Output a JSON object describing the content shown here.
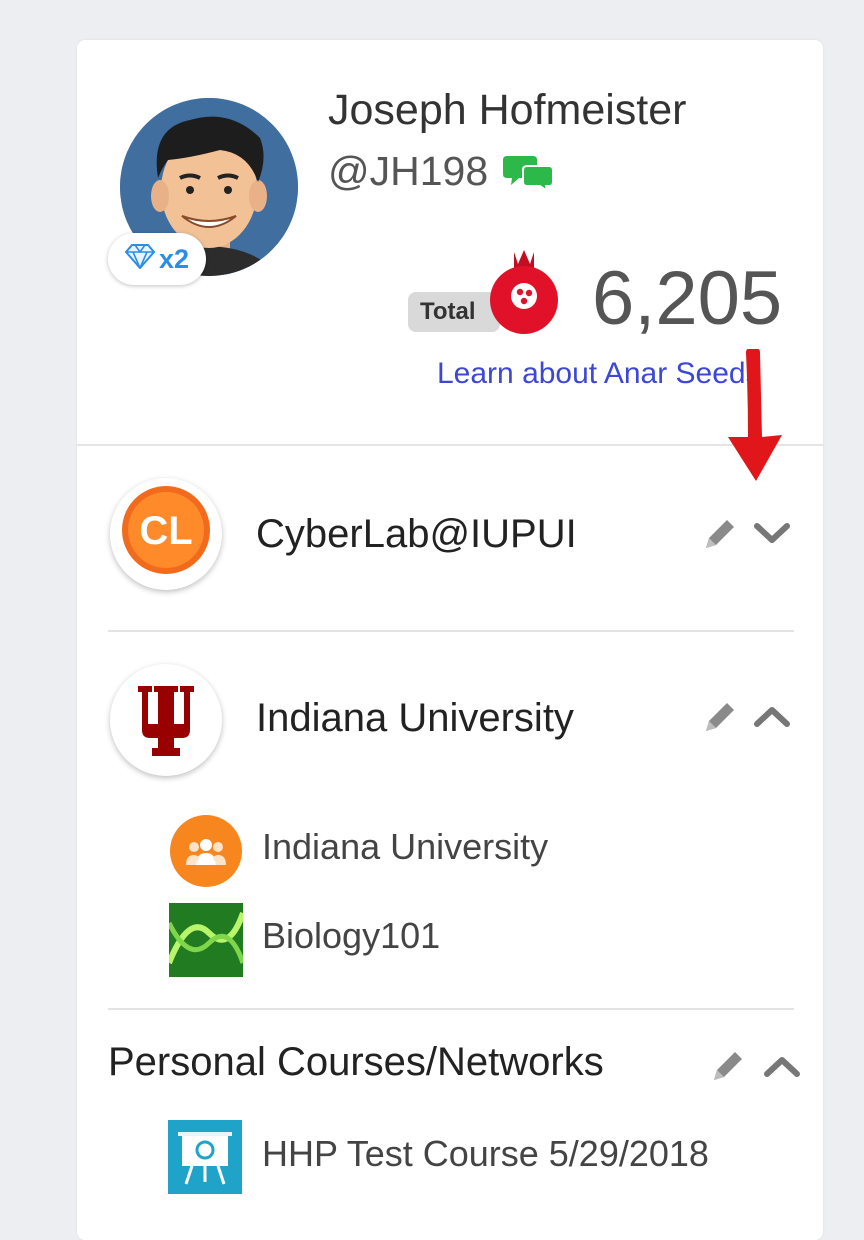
{
  "profile": {
    "name": "Joseph Hofmeister",
    "handle": "@JH198",
    "gem_multiplier": "x2",
    "total_label": "Total",
    "total_value": "6,205",
    "learn_link": "Learn about Anar Seeds"
  },
  "networks": [
    {
      "title": "CyberLab@IUPUI",
      "expanded": false,
      "logo": "cyberlab-logo"
    },
    {
      "title": "Indiana University",
      "expanded": true,
      "logo": "iu-trident-logo",
      "items": [
        {
          "label": "Indiana University",
          "icon": "group-icon"
        },
        {
          "label": "Biology101",
          "icon": "dna-thumbnail"
        }
      ]
    }
  ],
  "personal": {
    "title": "Personal Courses/Networks",
    "expanded": true,
    "items": [
      {
        "label": "HHP Test Course 5/29/2018",
        "icon": "presentation-board-icon"
      }
    ]
  },
  "colors": {
    "link": "#3d47d6",
    "iu_crimson": "#990000",
    "cyberlab_orange": "#f26b1d",
    "pomegranate_red": "#e2112a",
    "chat_green": "#2db84a",
    "gem_blue": "#2b8ee6",
    "annotation_arrow": "#e0161b"
  }
}
